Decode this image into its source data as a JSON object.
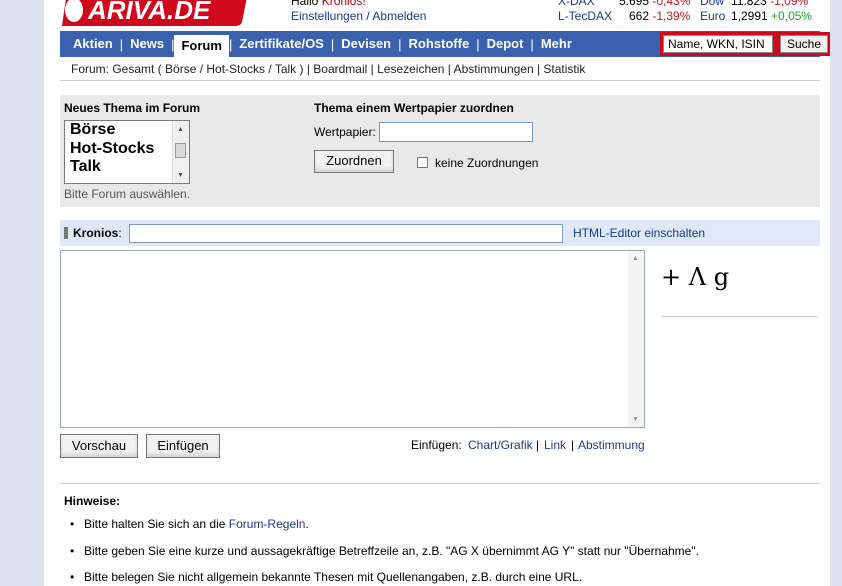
{
  "header": {
    "logo_text": "ARIVA.DE",
    "greeting_prefix": "Hallo",
    "user_name": "Kronios!",
    "settings_link": "Einstellungen",
    "link_sep": "/",
    "logout_link": "Abmelden"
  },
  "tickers": [
    {
      "name": "X-DAX",
      "value": "5.695",
      "change": "-0,43%",
      "dir": "neg"
    },
    {
      "name": "Dow",
      "value": "11.823",
      "change": "-1,09%",
      "dir": "neg"
    },
    {
      "name": "L-TecDAX",
      "value": "662",
      "change": "-1,39%",
      "dir": "neg"
    },
    {
      "name": "Euro",
      "value": "1,2991",
      "change": "+0,05%",
      "dir": "pos"
    }
  ],
  "nav": {
    "items": [
      "Aktien",
      "News",
      "Forum",
      "Zertifikate/OS",
      "Devisen",
      "Rohstoffe",
      "Depot",
      "Mehr"
    ],
    "active": "Forum",
    "separator": "|",
    "search_placeholder": "Name, WKN, ISIN",
    "search_button": "Suche"
  },
  "breadcrumb": {
    "text": "Forum: Gesamt ( Börse / Hot-Stocks / Talk ) | Boardmail | Lesezeichen | Abstimmungen | Statistik"
  },
  "new_topic": {
    "heading": "Neues Thema im Forum",
    "options": [
      "Börse",
      "Hot-Stocks",
      "Talk"
    ],
    "hint": "Bitte Forum auswählen."
  },
  "assign": {
    "heading": "Thema einem Wertpapier zuordnen",
    "label": "Wertpapier:",
    "button": "Zuordnen",
    "checkbox_label": "keine Zuordnungen"
  },
  "subject": {
    "label": "Kronios",
    "colon": ":",
    "html_editor_link": "HTML-Editor einschalten"
  },
  "editor": {
    "symbols": "+ Λ g"
  },
  "buttons": {
    "preview": "Vorschau",
    "insert": "Einfügen"
  },
  "insert_links": {
    "label": "Einfügen:",
    "chart": "Chart/Grafik",
    "link": "Link",
    "poll": "Abstimmung",
    "sep": "|"
  },
  "notes": {
    "title": "Hinweise:",
    "bullet": "•",
    "item1_prefix": "Bitte halten Sie sich an die",
    "item1_link": "Forum-Regeln",
    "item1_suffix": ".",
    "item2": "Bitte geben Sie eine kurze und aussagekräftige Betreffzeile an, z.B. \"AG X übernimmt AG Y\" statt nur \"Übernahme\".",
    "item3": "Bitte belegen Sie nicht allgemein bekannte Thesen mit Quellenangaben, z.B. durch eine URL."
  },
  "colors": {
    "nav_bg": "#3a61ad",
    "search_frame": "#d0081c",
    "negative": "#c8141e",
    "positive": "#2a9b2a",
    "link": "#1a3a8a"
  }
}
